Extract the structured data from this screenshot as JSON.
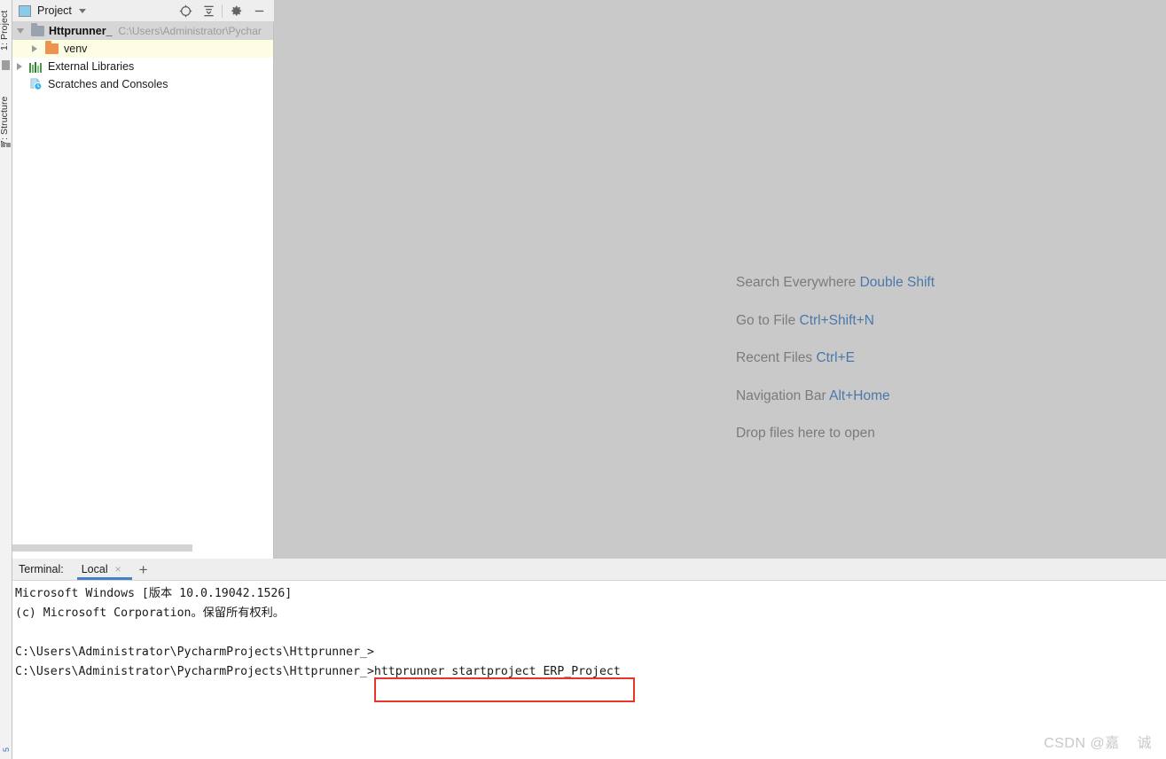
{
  "left_strip": {
    "tabs": [
      {
        "label": "1: Project"
      },
      {
        "label": "7: Structure"
      }
    ],
    "bottom_badge": "5"
  },
  "project_panel": {
    "header": {
      "title": "Project",
      "icons": [
        {
          "name": "locate-icon",
          "glyph": "⊕"
        },
        {
          "name": "collapse-all-icon",
          "glyph": "≛"
        },
        {
          "name": "gear-icon",
          "glyph": "✿"
        },
        {
          "name": "minimize-icon",
          "glyph": "—"
        }
      ]
    },
    "tree": [
      {
        "name": "Httprunner_",
        "path": "C:\\Users\\Administrator\\Pychar",
        "icon": "folder-gray-icon",
        "expanded": true,
        "selected": true
      },
      {
        "name": "venv",
        "icon": "folder-orange-icon",
        "expanded": false,
        "highlighted": true
      },
      {
        "name": "External Libraries",
        "icon": "libraries-icon",
        "expanded": false
      },
      {
        "name": "Scratches and Consoles",
        "icon": "scratches-icon"
      }
    ]
  },
  "editor": {
    "hints": [
      {
        "label": "Search Everywhere",
        "shortcut": "Double Shift"
      },
      {
        "label": "Go to File",
        "shortcut": "Ctrl+Shift+N"
      },
      {
        "label": "Recent Files",
        "shortcut": "Ctrl+E"
      },
      {
        "label": "Navigation Bar",
        "shortcut": "Alt+Home"
      },
      {
        "label": "Drop files here to open",
        "shortcut": ""
      }
    ]
  },
  "terminal": {
    "title": "Terminal:",
    "tab_label": "Local",
    "tab_close": "×",
    "new_tab": "+",
    "lines": [
      "Microsoft Windows [版本 10.0.19042.1526]",
      "(c) Microsoft Corporation。保留所有权利。",
      "",
      "C:\\Users\\Administrator\\PycharmProjects\\Httprunner_>",
      "C:\\Users\\Administrator\\PycharmProjects\\Httprunner_>httprunner startproject ERP_Project"
    ],
    "highlighted_command": "httprunner startproject ERP_Project",
    "highlight_color": "#e8352b"
  },
  "watermark": {
    "text": "CSDN @嘉    诚"
  },
  "colors": {
    "editor_background": "#c9c9c9",
    "panel_header": "#eeeeee",
    "selected_row": "#d6d6d6",
    "highlight_row": "#fdfde4",
    "accent_blue": "#4383c9",
    "hint_key": "#4a78ab"
  }
}
